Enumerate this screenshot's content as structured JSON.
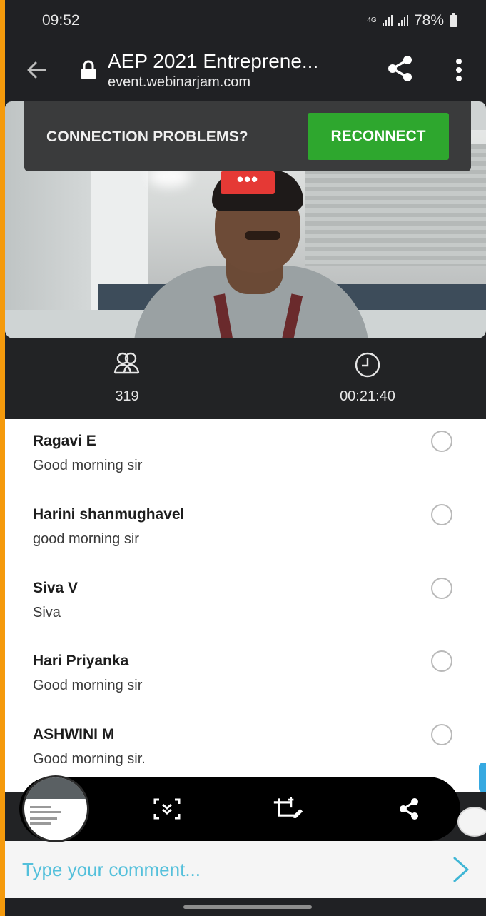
{
  "status_bar": {
    "time": "09:52",
    "network": "4G",
    "battery": "78%"
  },
  "browser": {
    "page_title": "AEP 2021 Entreprene...",
    "host": "event.webinarjam.com",
    "icons": [
      "back-arrow-icon",
      "lock-icon",
      "share-icon",
      "more-vert-icon"
    ]
  },
  "video": {
    "menu_label": "•••"
  },
  "banner": {
    "text": "CONNECTION PROBLEMS?",
    "button": "RECONNECT",
    "button_color": "#2ea72e"
  },
  "stats": {
    "viewers": "319",
    "elapsed": "00:21:40"
  },
  "comments": [
    {
      "name": "Ragavi E",
      "text": "Good morning sir"
    },
    {
      "name": "Harini shanmughavel",
      "text": "good morning sir"
    },
    {
      "name": "Siva V",
      "text": "Siva"
    },
    {
      "name": "Hari Priyanka",
      "text": "Good morning sir"
    },
    {
      "name": "ASHWINI M",
      "text": "Good morning sir."
    }
  ],
  "toolbar": {
    "icons": [
      "scroll-capture-icon",
      "crop-edit-icon",
      "share-icon"
    ]
  },
  "comment_input": {
    "placeholder": "Type your comment...",
    "accent_color": "#3fb6d5"
  }
}
